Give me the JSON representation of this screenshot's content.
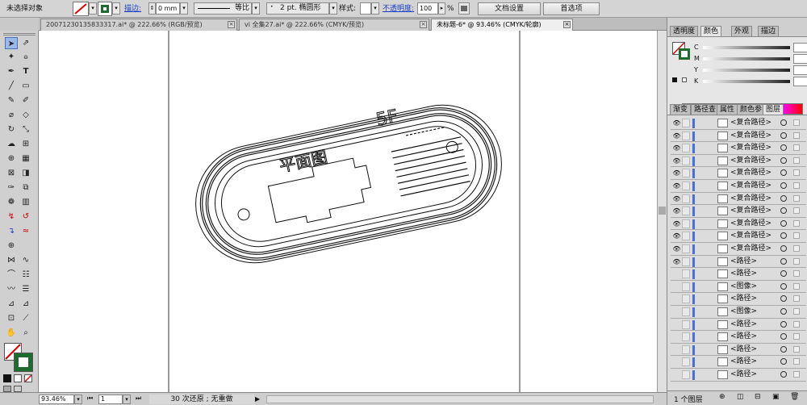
{
  "control_bar": {
    "selection_label": "未选择对象",
    "stroke_link": "描边:",
    "stroke_weight": "0 mm",
    "line_style": "等比",
    "brush": "2 pt. 椭圆形",
    "style_label": "样式:",
    "opacity_link": "不透明度:",
    "opacity_value": "100",
    "percent": "%",
    "doc_setup_button": "文档设置",
    "prefs_button": "首选项"
  },
  "doc_tabs": [
    {
      "label": "20071230135833317.ai* @ 222.66% (RGB/预览)"
    },
    {
      "label": "vi 全集27.ai* @ 222.66% (CMYK/预览)"
    },
    {
      "label": "未标题-6* @ 93.46% (CMYK/轮廓)"
    }
  ],
  "artwork": {
    "floor_text": "5F",
    "plan_text": "平面图"
  },
  "status_bar": {
    "zoom": "93.46%",
    "page": "1",
    "undo_text": "30 次还原 ; 无重做"
  },
  "panels": {
    "top_tabs": [
      "透明度",
      "颜色",
      "外观",
      "描边"
    ],
    "color_channels": [
      "C",
      "M",
      "Y",
      "K"
    ],
    "mid_tabs": [
      "渐变",
      "路径查",
      "属性",
      "颜色参",
      "图层"
    ],
    "layers": [
      {
        "name": "<复合路径>",
        "visible": true
      },
      {
        "name": "<复合路径>",
        "visible": true
      },
      {
        "name": "<复合路径>",
        "visible": true
      },
      {
        "name": "<复合路径>",
        "visible": true
      },
      {
        "name": "<复合路径>",
        "visible": true
      },
      {
        "name": "<复合路径>",
        "visible": true
      },
      {
        "name": "<复合路径>",
        "visible": true
      },
      {
        "name": "<复合路径>",
        "visible": true
      },
      {
        "name": "<复合路径>",
        "visible": true
      },
      {
        "name": "<复合路径>",
        "visible": true
      },
      {
        "name": "<复合路径>",
        "visible": true
      },
      {
        "name": "<路径>",
        "visible": true
      },
      {
        "name": "<路径>",
        "visible": false
      },
      {
        "name": "<图像>",
        "visible": false
      },
      {
        "name": "<路径>",
        "visible": false
      },
      {
        "name": "<图像>",
        "visible": false
      },
      {
        "name": "<路径>",
        "visible": false
      },
      {
        "name": "<路径>",
        "visible": false
      },
      {
        "name": "<路径>",
        "visible": false
      },
      {
        "name": "<路径>",
        "visible": false
      },
      {
        "name": "<路径>",
        "visible": false
      }
    ],
    "layer_count": "1 个图层"
  }
}
